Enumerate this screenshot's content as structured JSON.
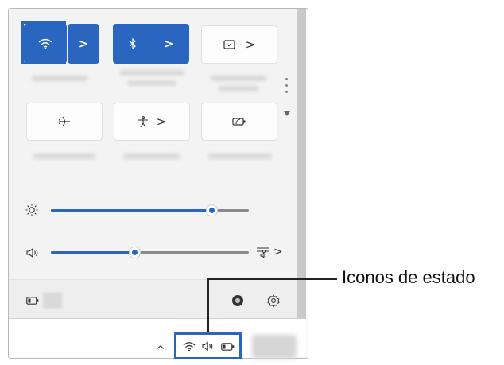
{
  "quick_settings": {
    "wifi": {
      "icon": "wifi-icon",
      "expand": ">"
    },
    "bluetooth": {
      "icon": "bluetooth-icon",
      "expand": ">"
    },
    "cast": {
      "icon": "cast-icon",
      "expand": ">"
    },
    "airplane": {
      "icon": "airplane-icon"
    },
    "accessibility": {
      "icon": "accessibility-icon",
      "expand": ">"
    },
    "battery_saver": {
      "icon": "battery-saver-icon"
    }
  },
  "sliders": {
    "brightness": {
      "icon": "brightness-icon",
      "level": 0.81
    },
    "volume": {
      "icon": "volume-icon",
      "level": 0.42,
      "output_expand": ">"
    }
  },
  "footer": {
    "battery_icon": "battery-icon",
    "edit_icon": "edit-icon",
    "settings_icon": "settings-icon"
  },
  "taskbar": {
    "overflow_chevron": "^"
  },
  "annotation": {
    "label": "Iconos de estado"
  },
  "colors": {
    "accent": "#2a66bf",
    "panel": "#f3f3f3"
  }
}
